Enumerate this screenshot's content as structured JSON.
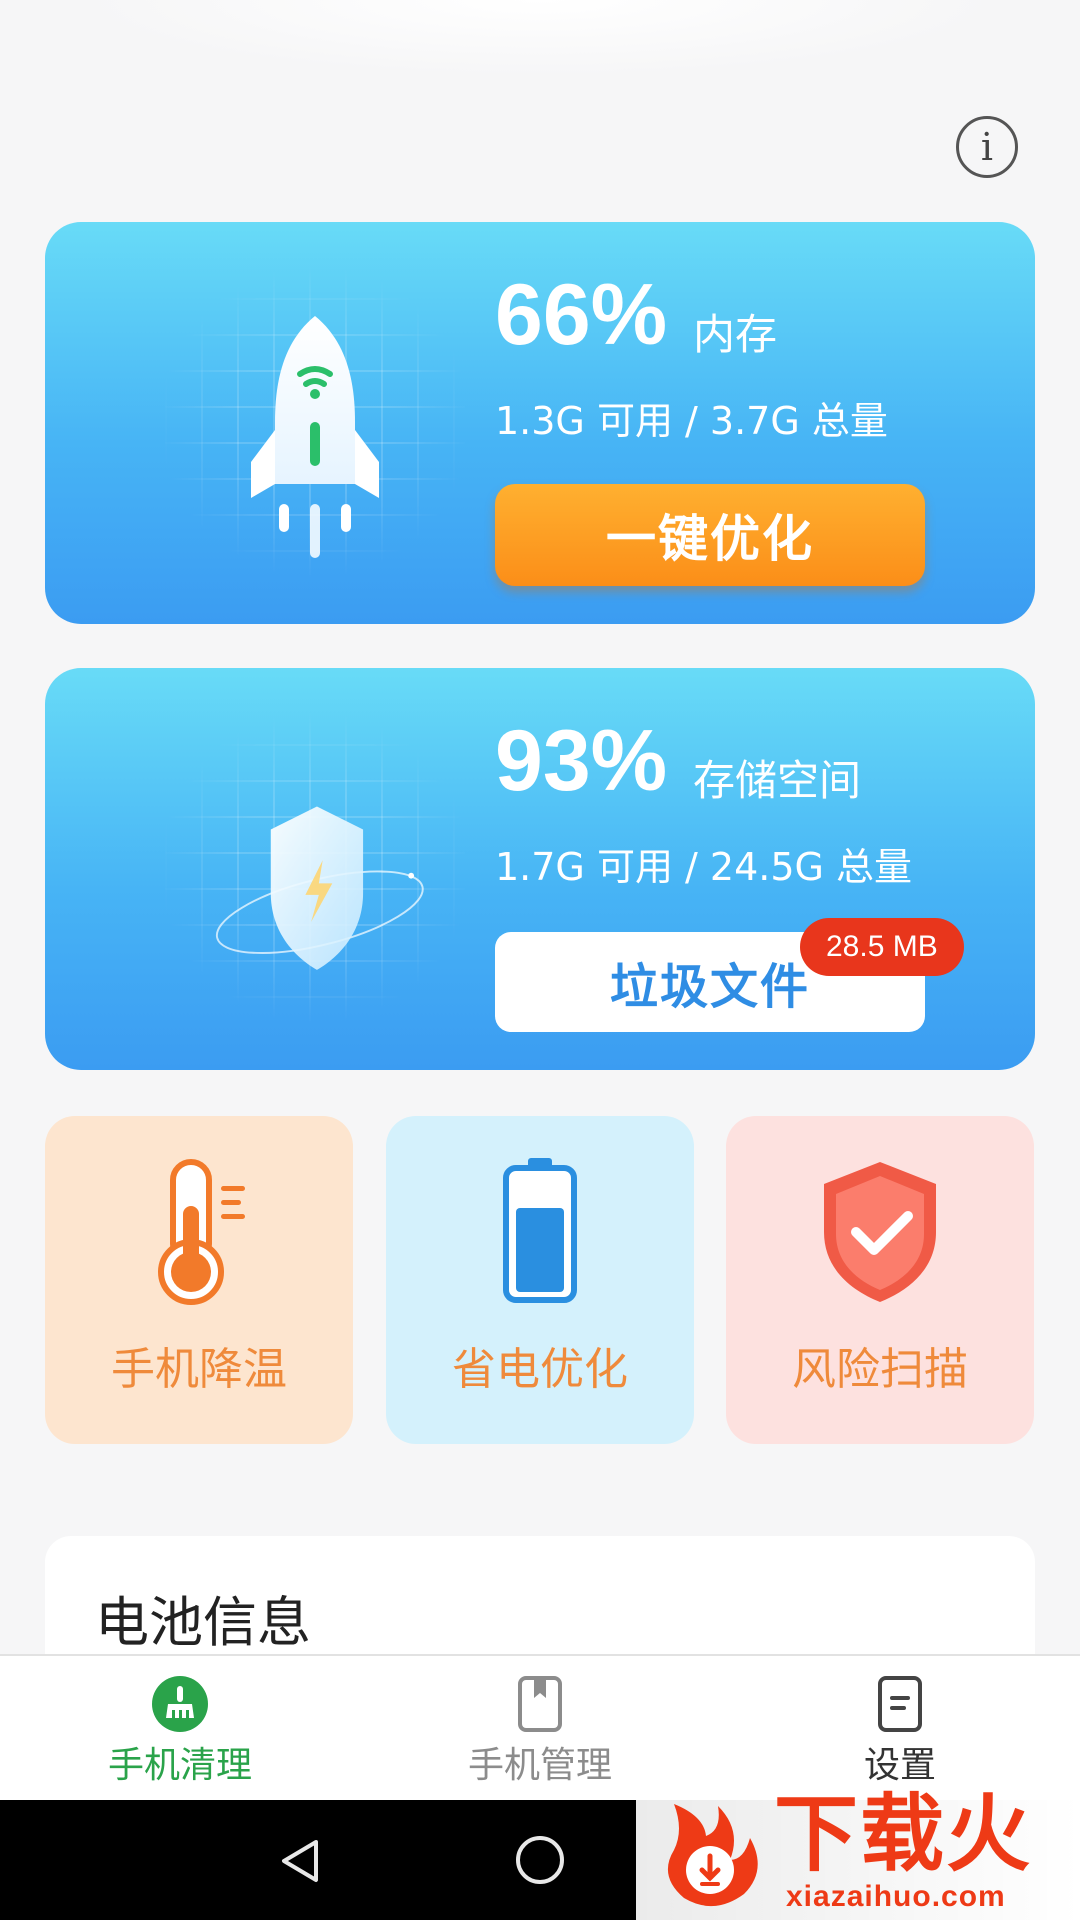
{
  "header": {
    "info_icon": "info-circle-icon"
  },
  "memory_card": {
    "percent": "66%",
    "label": "内存",
    "detail": "1.3G 可用 / 3.7G 总量",
    "button_label": "一键优化",
    "icon": "rocket-icon",
    "usage_fraction": 0.66
  },
  "storage_card": {
    "percent": "93%",
    "label": "存储空间",
    "detail": "1.7G 可用 / 24.5G 总量",
    "button_label": "垃圾文件",
    "badge": "28.5 MB",
    "icon": "shield-lightning-icon",
    "usage_fraction": 0.93
  },
  "tools": [
    {
      "label": "手机降温",
      "icon": "thermometer-icon",
      "bg": "#fde5cf"
    },
    {
      "label": "省电优化",
      "icon": "battery-icon",
      "bg": "#d4f1fc"
    },
    {
      "label": "风险扫描",
      "icon": "shield-check-icon",
      "bg": "#fde1df"
    }
  ],
  "battery_section": {
    "title": "电池信息"
  },
  "tabbar": {
    "tabs": [
      {
        "label": "手机清理",
        "icon": "broom-icon",
        "active": true
      },
      {
        "label": "手机管理",
        "icon": "bookmark-icon",
        "active": false
      },
      {
        "label": "设置",
        "icon": "document-icon",
        "active": false
      }
    ]
  },
  "system_nav": {
    "back_icon": "back-triangle-icon",
    "home_icon": "home-circle-icon"
  },
  "watermark": {
    "title": "下载火",
    "url": "xiazaihuo.com"
  },
  "colors": {
    "card_blue": "#47b4f5",
    "button_orange": "#fb8e18",
    "badge_red": "#e8361c",
    "active_green": "#2aa34a",
    "tool_label_orange": "#ef8a3b"
  }
}
